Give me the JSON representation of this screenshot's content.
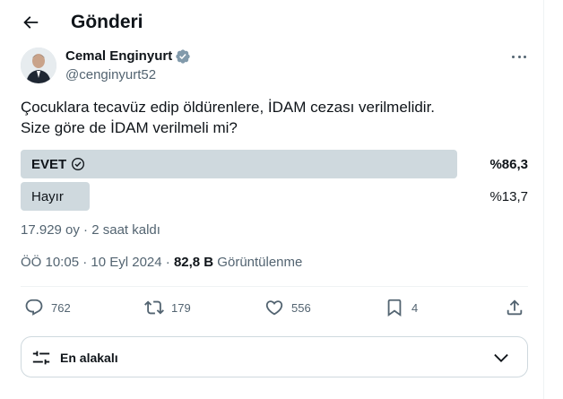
{
  "header": {
    "title": "Gönderi"
  },
  "author": {
    "name": "Cemal Enginyurt",
    "handle": "@cenginyurt52"
  },
  "tweet": {
    "lines": [
      "Çocuklara tecavüz edip öldürenlere, İDAM cezası verilmelidir.",
      "Size göre de İDAM verilmeli mi?"
    ]
  },
  "poll": {
    "options": [
      {
        "label": "EVET",
        "percent_text": "%86,3",
        "percent": 86.3,
        "winner": true
      },
      {
        "label": "Hayır",
        "percent_text": "%13,7",
        "percent": 13.7,
        "winner": false
      }
    ],
    "meta": "17.929 oy · 2 saat kaldı",
    "bar_color_winner": "#cfd9de",
    "bar_color_other": "#cfd9de"
  },
  "timestamp": {
    "date_text": "ÖÖ 10:05 · 10 Eyl 2024 · ",
    "views_count": "82,8 B",
    "views_label": " Görüntülenme"
  },
  "actions": {
    "replies": "762",
    "reposts": "179",
    "likes": "556",
    "bookmarks": "4"
  },
  "sort": {
    "label": "En alakalı"
  },
  "colors": {
    "text": "#0f1419",
    "secondary": "#536471",
    "verified": "#829aab",
    "border": "#cfd9de"
  }
}
